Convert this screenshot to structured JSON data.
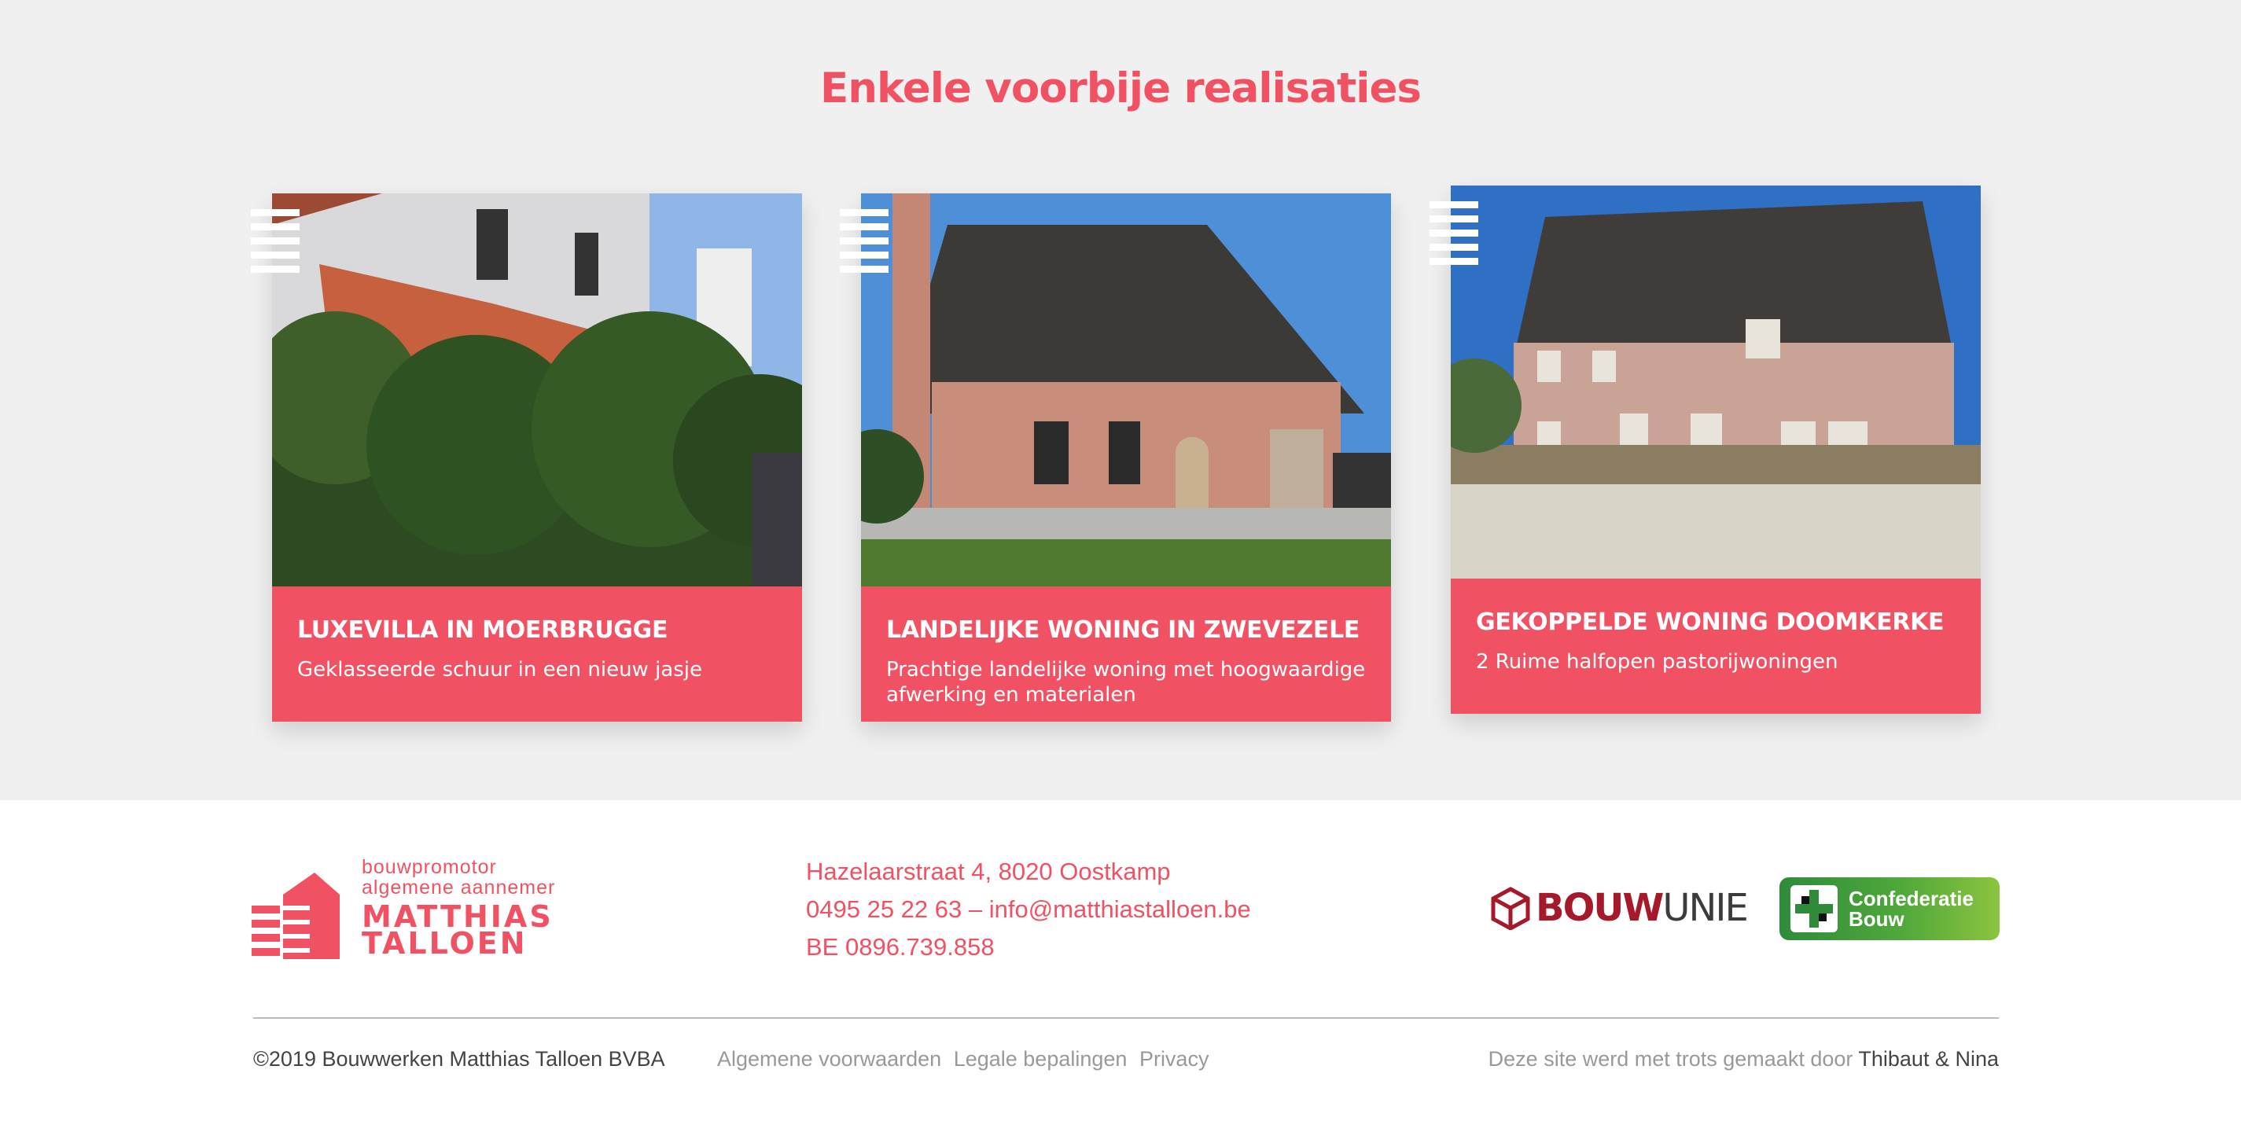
{
  "section": {
    "title": "Enkele voorbije realisaties"
  },
  "projects": [
    {
      "title": "LUXEVILLA IN MOERBRUGGE",
      "description": "Geklasseerde schuur in een nieuw jasje"
    },
    {
      "title": "LANDELIJKE WONING IN ZWEVEZELE",
      "description": "Prachtige landelijke woning met hoogwaardige afwerking en materialen"
    },
    {
      "title": "GEKOPPELDE WONING DOOMKERKE",
      "description": "2 Ruime halfopen pastorijwoningen"
    }
  ],
  "footer": {
    "logo": {
      "line1": "bouwpromotor",
      "line2": "algemene aannemer",
      "line3": "MATTHIAS",
      "line4": "TALLOEN"
    },
    "contact": {
      "address": "Hazelaarstraat 4, 8020 Oostkamp",
      "phone_email": "0495 25 22 63 – info@matthiastalloen.be",
      "vat": "BE 0896.739.858"
    },
    "partners": {
      "bouwunie_part1": "BOUW",
      "bouwunie_part2": "UNIE",
      "confederatie_line1": "Confederatie",
      "confederatie_line2": "Bouw"
    },
    "copyright": "©2019 Bouwwerken Matthias Talloen BVBA",
    "links": [
      "Algemene voorwaarden",
      "Legale bepalingen",
      "Privacy"
    ],
    "credit_prefix": "Deze site werd met trots gemaakt door",
    "credit_names": "Thibaut & Nina"
  },
  "colors": {
    "accent": "#f15263",
    "background_section": "#f0f0f0",
    "bouwunie_red": "#a5192b",
    "confederatie_green": "#4fa83a"
  }
}
